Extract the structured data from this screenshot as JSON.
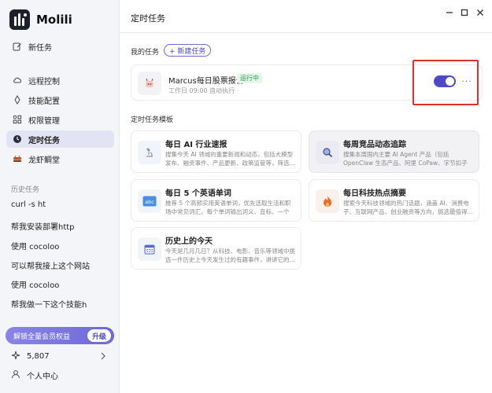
{
  "app": {
    "name": "Molili"
  },
  "sidebar": {
    "new_task": "新任务",
    "nav": [
      {
        "label": "远程控制"
      },
      {
        "label": "技能配置"
      },
      {
        "label": "权限管理"
      },
      {
        "label": "定时任务"
      },
      {
        "label": "龙虾鲷堂"
      }
    ],
    "history_label": "历史任务",
    "history": [
      "curl -s ht",
      "帮我安装部署http",
      "使用 cocoloo",
      "可以帮我接上这个网站",
      "使用 cocoloo",
      "帮我做一下这个技能h"
    ],
    "member_text": "解锁全量会员权益",
    "upgrade": "升级",
    "points": "5,807",
    "user_center": "个人中心"
  },
  "main": {
    "title": "定时任务",
    "my_tasks_label": "我的任务",
    "new_task_btn": "+ 新建任务",
    "task": {
      "name": "Marcus每日股票报告",
      "status": "运行中",
      "schedule": "工作日 09:00 自动执行",
      "enabled": true
    },
    "templates_label": "定时任务模板",
    "templates": [
      {
        "title": "每日 AI 行业速报",
        "desc": "搜集今天 AI 领域的重要新闻和动态，包括大模型发布、融资事件、产品更新、政策监管等，筛选..."
      },
      {
        "title": "每周竞品动态追踪",
        "desc": "搜集本周国内主要 AI Agent 产品（包括 OpenClaw 生态产品、阿里 CoPaw、字节扣子等）的最新动..."
      },
      {
        "title": "每日 5 个英语单词",
        "desc": "推荐 5 个高频实用英语单词，优先选取生活和职场中常见词汇。每个单词输出词义、音标、一个实..."
      },
      {
        "title": "每日科技热点摘要",
        "desc": "搜索今天科技领域的热门话题，涵盖 AI、消费电子、互联网产品、创业融资等方向，挑选最值得..."
      },
      {
        "title": "历史上的今天",
        "desc": "今天是几月几日？从科技、电影、音乐等领域中挑选一件历史上今天发生过的有趣事件，讲讲它的..."
      }
    ]
  },
  "icons": {
    "new_task": "edit-icon",
    "remote": "cloud-icon",
    "skills": "tool-icon",
    "permissions": "grid-icon",
    "schedule": "clock-icon",
    "lobster": "lobster-icon",
    "points": "sparkle-icon",
    "user": "user-icon"
  },
  "colors": {
    "accent": "#4d49c8",
    "running": "#2f9a53",
    "highlight": "#e0302b"
  }
}
